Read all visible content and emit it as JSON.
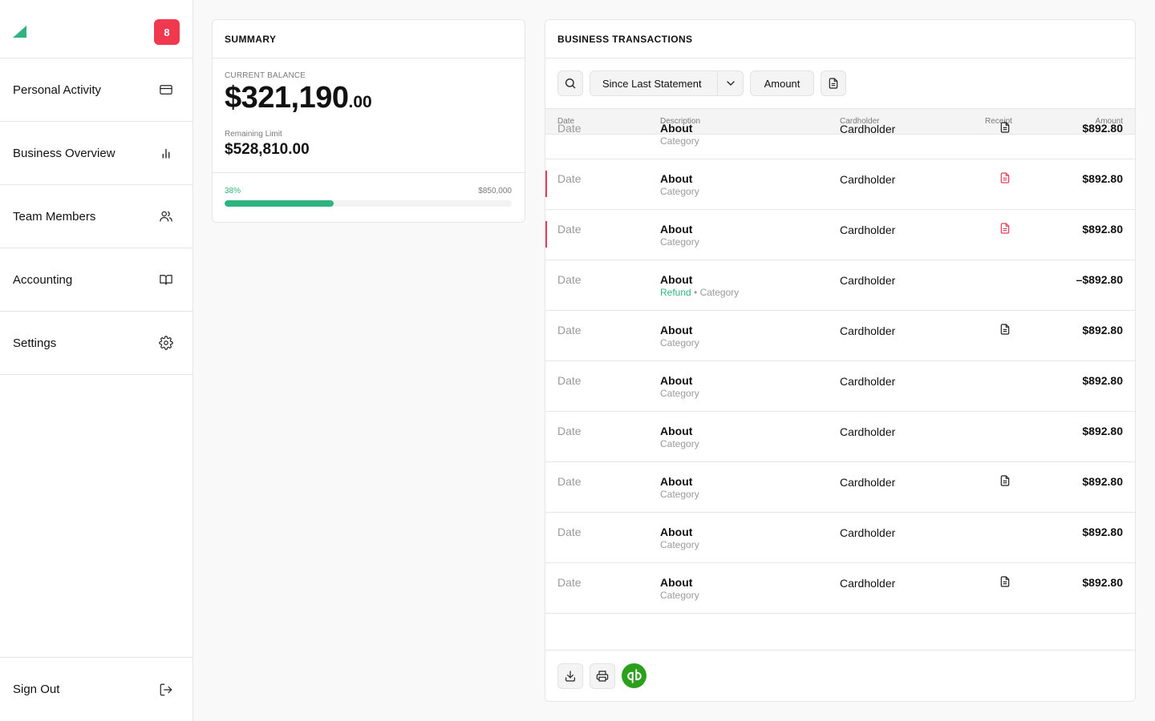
{
  "sidebar": {
    "badge_count": "8",
    "items": [
      {
        "label": "Personal Activity",
        "icon": "credit-card-icon"
      },
      {
        "label": "Business Overview",
        "icon": "bar-chart-icon"
      },
      {
        "label": "Team Members",
        "icon": "users-icon"
      },
      {
        "label": "Accounting",
        "icon": "book-icon"
      },
      {
        "label": "Settings",
        "icon": "gear-icon"
      }
    ],
    "sign_out": {
      "label": "Sign Out",
      "icon": "logout-icon"
    }
  },
  "summary": {
    "title": "SUMMARY",
    "current_balance_label": "CURRENT BALANCE",
    "balance_whole": "$321,190",
    "balance_cents": ".00",
    "remaining_limit_label": "Remaining Limit",
    "remaining_limit_value": "$528,810.00",
    "progress_percent_label": "38%",
    "progress_fraction": 0.38,
    "limit_total": "$850,000"
  },
  "transactions": {
    "title": "BUSINESS TRANSACTIONS",
    "filter_period": "Since Last Statement",
    "amount_button": "Amount",
    "columns": {
      "date": "Date",
      "description": "Description",
      "cardholder": "Cardholder",
      "receipt": "Receipt",
      "amount": "Amount"
    },
    "rows": [
      {
        "date": "Date",
        "about": "About",
        "refund": "",
        "category": "Category",
        "cardholder": "Cardholder",
        "receipt": "ok",
        "amount": "$892.80",
        "flag": false
      },
      {
        "date": "Date",
        "about": "About",
        "refund": "",
        "category": "Category",
        "cardholder": "Cardholder",
        "receipt": "missing",
        "amount": "$892.80",
        "flag": true
      },
      {
        "date": "Date",
        "about": "About",
        "refund": "",
        "category": "Category",
        "cardholder": "Cardholder",
        "receipt": "missing",
        "amount": "$892.80",
        "flag": true
      },
      {
        "date": "Date",
        "about": "About",
        "refund": "Refund",
        "category": "Category",
        "cardholder": "Cardholder",
        "receipt": "none",
        "amount": "–$892.80",
        "flag": false
      },
      {
        "date": "Date",
        "about": "About",
        "refund": "",
        "category": "Category",
        "cardholder": "Cardholder",
        "receipt": "ok",
        "amount": "$892.80",
        "flag": false
      },
      {
        "date": "Date",
        "about": "About",
        "refund": "",
        "category": "Category",
        "cardholder": "Cardholder",
        "receipt": "none",
        "amount": "$892.80",
        "flag": false
      },
      {
        "date": "Date",
        "about": "About",
        "refund": "",
        "category": "Category",
        "cardholder": "Cardholder",
        "receipt": "none",
        "amount": "$892.80",
        "flag": false
      },
      {
        "date": "Date",
        "about": "About",
        "refund": "",
        "category": "Category",
        "cardholder": "Cardholder",
        "receipt": "ok",
        "amount": "$892.80",
        "flag": false
      },
      {
        "date": "Date",
        "about": "About",
        "refund": "",
        "category": "Category",
        "cardholder": "Cardholder",
        "receipt": "none",
        "amount": "$892.80",
        "flag": false
      },
      {
        "date": "Date",
        "about": "About",
        "refund": "",
        "category": "Category",
        "cardholder": "Cardholder",
        "receipt": "ok",
        "amount": "$892.80",
        "flag": false
      }
    ],
    "footer_icons": [
      "download-icon",
      "printer-icon",
      "quickbooks-logo"
    ]
  },
  "colors": {
    "accent": "#2fb380",
    "alert": "#f0384f",
    "receipt_missing": "#e83a54",
    "quickbooks": "#2ca01c"
  }
}
